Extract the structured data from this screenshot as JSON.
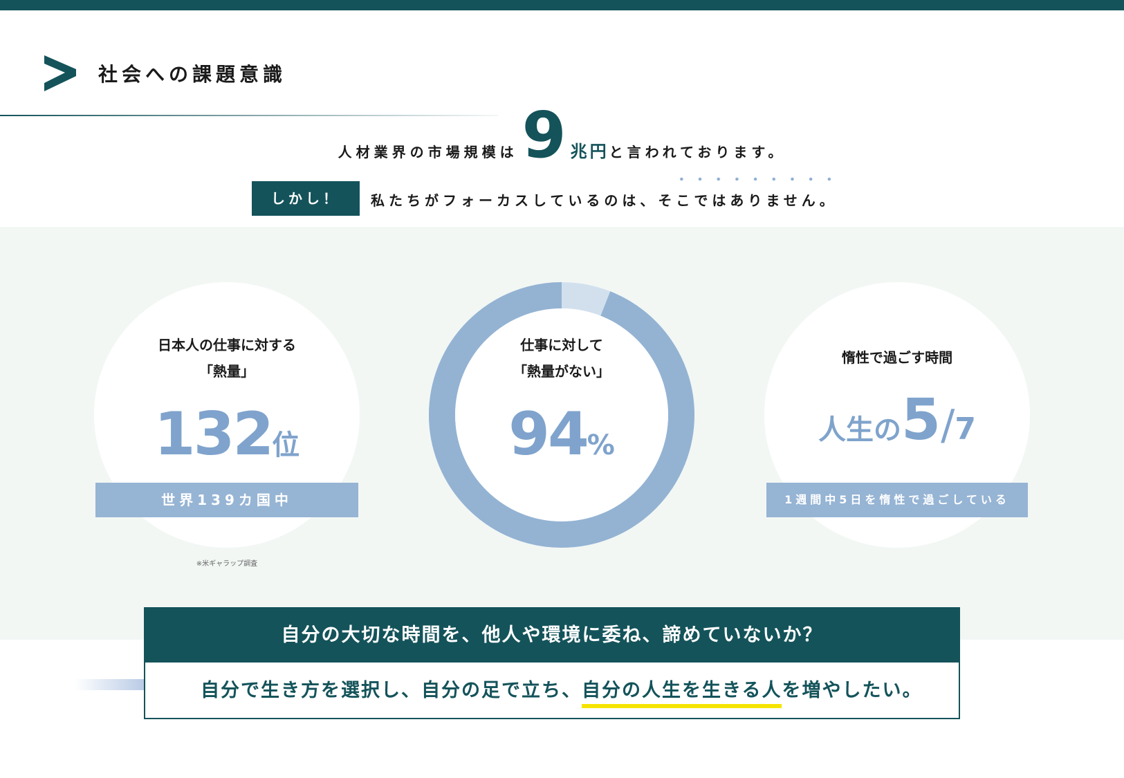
{
  "header": {
    "title": "社会への課題意識"
  },
  "intro": {
    "prefix": "人材業界の市場規模は",
    "big_number": "9",
    "unit": "兆円",
    "suffix": "と言われております。",
    "badge": "しかし！",
    "message": "私たちがフォーカスしているのは、そこではありません。"
  },
  "stats": {
    "left": {
      "heading_line1": "日本人の仕事に対する",
      "heading_line2": "「熱量」",
      "value": "132",
      "suffix": "位",
      "bar": "世界139カ国中",
      "note": "※米ギャラップ調査"
    },
    "center": {
      "heading_line1": "仕事に対して",
      "heading_line2": "「熱量がない」",
      "value": "94",
      "suffix": "%",
      "percent": 94
    },
    "right": {
      "heading": "惰性で過ごす時間",
      "prefix": "人生の",
      "numerator": "5",
      "slash": "/",
      "denominator": "7",
      "bar": "1週間中5日を惰性で過ごしている"
    }
  },
  "bottom": {
    "question": "自分の大切な時間を、他人や環境に委ね、諦めていないか？",
    "answer_start": "自分で生き方を選択し、自分の足で立ち、",
    "answer_highlight": "自分の人生を生きる人",
    "answer_end": "を増やしたい。"
  },
  "colors": {
    "brand": "#14535a",
    "accent_blue": "#96b4d4",
    "band": "#f2f7f4",
    "highlight": "#f5e400"
  }
}
